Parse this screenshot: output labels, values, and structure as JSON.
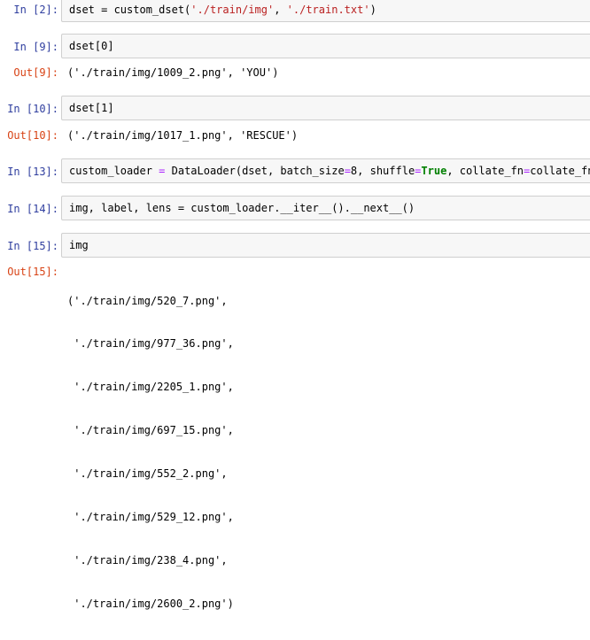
{
  "cells": [
    {
      "in_prompt": "In [2]:",
      "code": {
        "pre": "dset = custom_dset(",
        "s1": "'./train/img'",
        "mid": ", ",
        "s2": "'./train.txt'",
        "post": ")"
      }
    },
    {
      "in_prompt": "In [9]:",
      "code": "dset[0]",
      "out_prompt": "Out[9]:",
      "output": "('./train/img/1009_2.png', 'YOU')"
    },
    {
      "in_prompt": "In [10]:",
      "code": "dset[1]",
      "out_prompt": "Out[10]:",
      "output": "('./train/img/1017_1.png', 'RESCUE')"
    },
    {
      "in_prompt": "In [13]:",
      "code": {
        "pre": "custom_loader ",
        "eq1": "=",
        "mid1": " DataLoader(dset, batch_size",
        "eq2": "=",
        "mid2": "8, shuffle",
        "eq3": "=",
        "kw": "True",
        "mid3": ", collate_fn",
        "eq4": "=",
        "post": "collate_fn)"
      }
    },
    {
      "in_prompt": "In [14]:",
      "code": "img, label, lens = custom_loader.__iter__().__next__()"
    },
    {
      "in_prompt": "In [15]:",
      "code": "img",
      "out_prompt": "Out[15]:",
      "output_lines": [
        "('./train/img/520_7.png',",
        " './train/img/977_36.png',",
        " './train/img/2205_1.png',",
        " './train/img/697_15.png',",
        " './train/img/552_2.png',",
        " './train/img/529_12.png',",
        " './train/img/238_4.png',",
        " './train/img/2600_2.png')"
      ]
    }
  ]
}
